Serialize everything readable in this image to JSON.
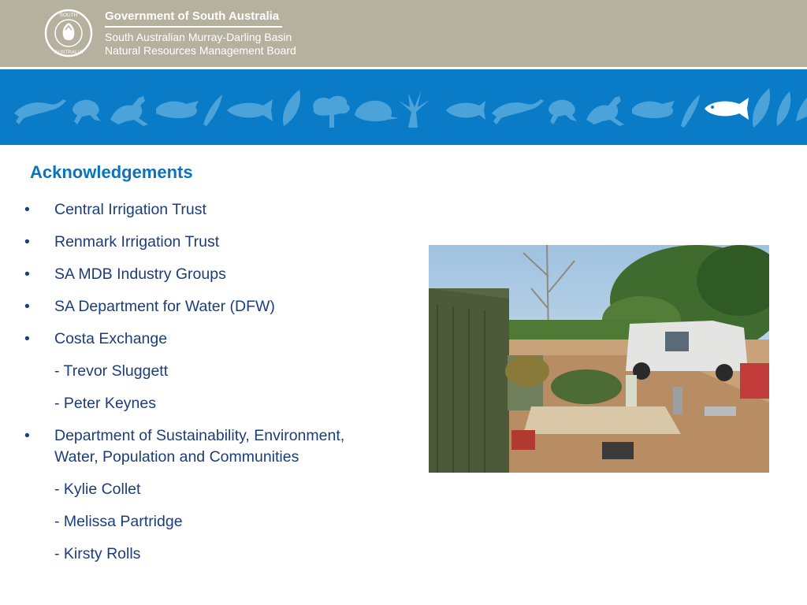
{
  "header": {
    "organisation": "Government of South Australia",
    "board_line_1": "South Australian Murray-Darling Basin",
    "board_line_2": "Natural Resources Management Board",
    "crest_text": "SOUTH AUSTRALIA"
  },
  "banner": {
    "color": "#0a7bc7",
    "icons": [
      "lizard-icon",
      "frog-icon",
      "kangaroo-icon",
      "bird-icon",
      "leaf-icon",
      "fish-icon",
      "gum-leaf-icon",
      "tree-icon",
      "echidna-icon",
      "grass-tree-icon",
      "fish-icon",
      "lizard-icon",
      "frog-icon",
      "kangaroo-icon",
      "bird-icon",
      "wheat-icon",
      "fish-icon",
      "gum-leaf-icon"
    ]
  },
  "slide": {
    "title": "Acknowledgements",
    "items": [
      "Central Irrigation Trust",
      "Renmark Irrigation Trust",
      "SA MDB Industry Groups",
      "SA Department for Water (DFW)",
      "Costa Exchange",
      "- Trevor Sluggett",
      "- Peter Keynes",
      "Department of Sustainability, Environment,",
      "Water, Population and Communities",
      "- Kylie Collet",
      "- Melissa Partridge",
      "- Kirsty Rolls"
    ],
    "bullet_char": "•"
  },
  "photo": {
    "subject": "irrigation-pump-site-photo"
  }
}
